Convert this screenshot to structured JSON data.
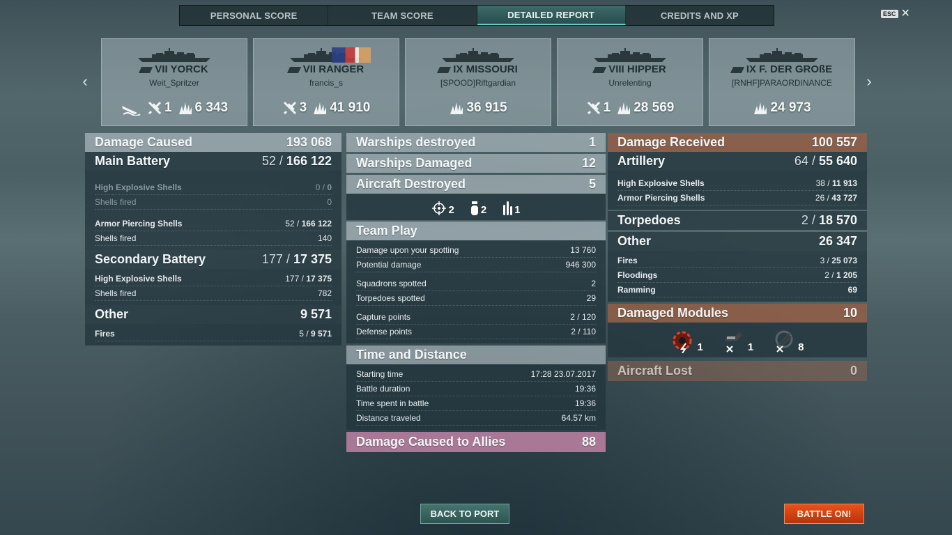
{
  "tabs": [
    "PERSONAL SCORE",
    "TEAM SCORE",
    "DETAILED REPORT",
    "CREDITS AND XP"
  ],
  "esc_label": "ESC",
  "ships": [
    {
      "tier": "VII",
      "name": "YORCK",
      "player": "Weit_Spritzer",
      "ship_sunk": true,
      "planes": "1",
      "damage": "6 343",
      "has_flag": false
    },
    {
      "tier": "VII",
      "name": "RANGER",
      "player": "francis_s",
      "ship_sunk": false,
      "planes": "3",
      "damage": "41 910",
      "has_flag": true
    },
    {
      "tier": "IX",
      "name": "MISSOURI",
      "player": "[SPOOD]Riftgardian",
      "ship_sunk": false,
      "planes": "",
      "damage": "36 915",
      "has_flag": false
    },
    {
      "tier": "VIII",
      "name": "HIPPER",
      "player": "Unrelenting",
      "ship_sunk": false,
      "planes": "1",
      "damage": "28 569",
      "has_flag": false
    },
    {
      "tier": "IX",
      "name": "F. DER GROßE",
      "player": "[RNHF]PARAORDINANCE",
      "ship_sunk": false,
      "planes": "",
      "damage": "24 973",
      "has_flag": false
    }
  ],
  "left": {
    "damage_caused": {
      "label": "Damage Caused",
      "value": "193 068"
    },
    "main_battery": {
      "label": "Main Battery",
      "hits": "52",
      "total": "166 122"
    },
    "he_shells": {
      "label": "High Explosive Shells",
      "hits": "0",
      "total": "0"
    },
    "he_fired": {
      "label": "Shells fired",
      "value": "0"
    },
    "ap_shells": {
      "label": "Armor Piercing Shells",
      "hits": "52",
      "total": "166 122"
    },
    "ap_fired": {
      "label": "Shells fired",
      "value": "140"
    },
    "secondary": {
      "label": "Secondary Battery",
      "hits": "177",
      "total": "17 375"
    },
    "sec_he": {
      "label": "High Explosive Shells",
      "hits": "177",
      "total": "17 375"
    },
    "sec_fired": {
      "label": "Shells fired",
      "value": "782"
    },
    "other": {
      "label": "Other",
      "value": "9 571"
    },
    "fires": {
      "label": "Fires",
      "hits": "5",
      "total": "9 571"
    }
  },
  "middle": {
    "warships_destroyed": {
      "label": "Warships destroyed",
      "value": "1"
    },
    "warships_damaged": {
      "label": "Warships Damaged",
      "value": "12"
    },
    "aircraft_destroyed": {
      "label": "Aircraft Destroyed",
      "value": "5"
    },
    "aircraft_icons": [
      {
        "icon": "crosshair-icon",
        "count": "2"
      },
      {
        "icon": "bomb-icon",
        "count": "2"
      },
      {
        "icon": "torpedo-icon",
        "count": "1"
      }
    ],
    "team_play": {
      "title": "Team Play",
      "rows": [
        {
          "label": "Damage upon your spotting",
          "value": "13 760"
        },
        {
          "label": "Potential damage",
          "value": "946 300"
        },
        {
          "label": "Squadrons spotted",
          "value": "2"
        },
        {
          "label": "Torpedoes spotted",
          "value": "29"
        },
        {
          "label": "Capture points",
          "value": "2 / 120"
        },
        {
          "label": "Defense points",
          "value": "2 / 110"
        }
      ]
    },
    "time_distance": {
      "title": "Time and Distance",
      "rows": [
        {
          "label": "Starting time",
          "value": "17:28  23.07.2017"
        },
        {
          "label": "Battle duration",
          "value": "19:36"
        },
        {
          "label": "Time spent in battle",
          "value": "19:36"
        },
        {
          "label": "Distance traveled",
          "value": "64.57 km"
        }
      ]
    },
    "allies": {
      "label": "Damage Caused to Allies",
      "value": "88"
    }
  },
  "right": {
    "damage_received": {
      "label": "Damage Received",
      "value": "100 557"
    },
    "artillery": {
      "label": "Artillery",
      "hits": "64",
      "total": "55 640"
    },
    "he_shells": {
      "label": "High Explosive Shells",
      "hits": "38",
      "total": "11 913"
    },
    "ap_shells": {
      "label": "Armor Piercing Shells",
      "hits": "26",
      "total": "43 727"
    },
    "torpedoes": {
      "label": "Torpedoes",
      "hits": "2",
      "total": "18 570"
    },
    "other": {
      "label": "Other",
      "value": "26 347"
    },
    "fires": {
      "label": "Fires",
      "hits": "3",
      "total": "25 073"
    },
    "floodings": {
      "label": "Floodings",
      "hits": "2",
      "total": "1 205"
    },
    "ramming": {
      "label": "Ramming",
      "value": "69"
    },
    "damaged_modules": {
      "label": "Damaged Modules",
      "value": "10"
    },
    "module_icons": [
      {
        "icon": "engine-damaged-icon",
        "count": "1"
      },
      {
        "icon": "turret-destroyed-icon",
        "count": "1"
      },
      {
        "icon": "aa-gun-destroyed-icon",
        "count": "8"
      }
    ],
    "aircraft_lost": {
      "label": "Aircraft Lost",
      "value": "0"
    }
  },
  "buttons": {
    "back": "BACK TO PORT",
    "battle": "BATTLE ON!"
  },
  "colors": {
    "accent": "#5fd0c8",
    "battle": "#e8531a",
    "rust": "#965f46",
    "allies": "#be82a5"
  }
}
